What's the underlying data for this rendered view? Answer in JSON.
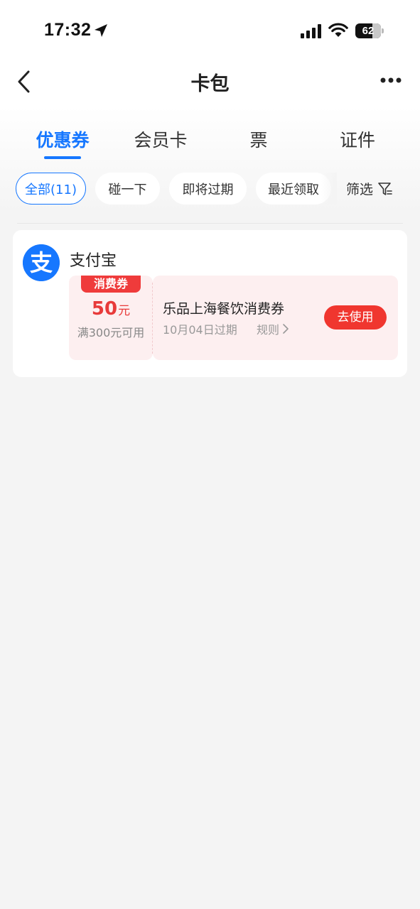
{
  "status_bar": {
    "time": "17:32",
    "battery": "62"
  },
  "nav": {
    "title": "卡包",
    "back_icon": "chevron-left-icon",
    "more_icon": "more-horizontal-icon"
  },
  "tabs": [
    {
      "label": "优惠券",
      "active": true
    },
    {
      "label": "会员卡",
      "active": false
    },
    {
      "label": "票",
      "active": false
    },
    {
      "label": "证件",
      "active": false
    }
  ],
  "filters": {
    "chips": [
      {
        "label": "全部(11)",
        "active": true
      },
      {
        "label": "碰一下",
        "active": false
      },
      {
        "label": "即将过期",
        "active": false
      },
      {
        "label": "最近领取",
        "active": false
      }
    ],
    "filter_label": "筛选",
    "filter_icon": "filter-icon"
  },
  "coupon_group": {
    "merchant": "支付宝",
    "logo_icon": "alipay-logo",
    "coupon": {
      "tag": "消费券",
      "amount": "50",
      "unit": "元",
      "condition": "满300元可用",
      "title": "乐品上海餐饮消费券",
      "expiry": "10月04日过期",
      "rules": "规则",
      "use_button": "去使用"
    }
  },
  "colors": {
    "accent": "#1677ff",
    "coupon_red": "#f0362f",
    "coupon_bg": "#fdeff0"
  }
}
